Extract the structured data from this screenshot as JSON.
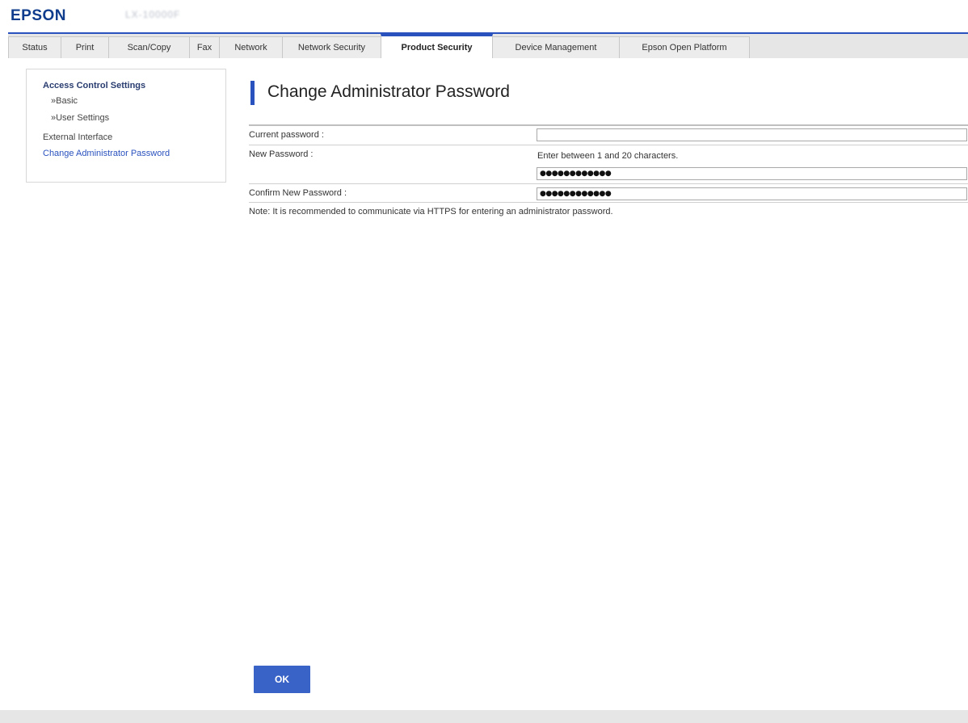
{
  "header": {
    "brand": "EPSON",
    "model": "LX-10000F"
  },
  "tabs": [
    {
      "label": "Status"
    },
    {
      "label": "Print"
    },
    {
      "label": "Scan/Copy"
    },
    {
      "label": "Fax"
    },
    {
      "label": "Network"
    },
    {
      "label": "Network Security"
    },
    {
      "label": "Product Security",
      "active": true
    },
    {
      "label": "Device Management"
    },
    {
      "label": "Epson Open Platform"
    }
  ],
  "sidebar": {
    "group_title": "Access Control Settings",
    "sub_items": [
      "»Basic",
      "»User Settings"
    ],
    "items": [
      {
        "label": "External Interface"
      },
      {
        "label": "Change Administrator Password",
        "active": true
      }
    ]
  },
  "main": {
    "title": "Change Administrator Password",
    "current_password": {
      "label": "Current password :",
      "value": ""
    },
    "new_password": {
      "label": "New Password :",
      "hint": "Enter between 1 and 20 characters.",
      "value": "●●●●●●●●●●●●"
    },
    "confirm_password": {
      "label": "Confirm New Password :",
      "value": "●●●●●●●●●●●●"
    },
    "note": "Note: It is recommended to communicate via HTTPS for entering an administrator password.",
    "ok_label": "OK"
  },
  "colors": {
    "accent": "#2a52be",
    "brand": "#0f3c8c",
    "button": "#3a63c8"
  }
}
